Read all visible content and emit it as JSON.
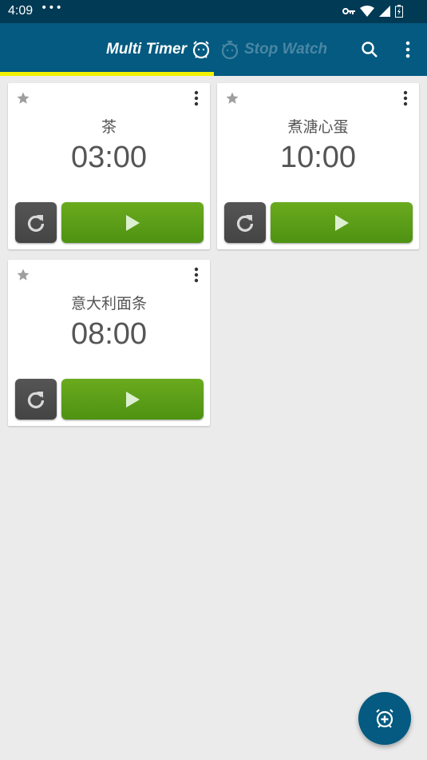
{
  "status_bar": {
    "time": "4:09",
    "overflow": "•••",
    "icons": [
      "vpn-key-icon",
      "wifi-icon",
      "signal-icon",
      "battery-charging-icon"
    ]
  },
  "app_bar": {
    "tabs": [
      {
        "label": "Multi Timer",
        "icon": "alarm-clock-face-icon",
        "selected": true
      },
      {
        "label": "Stop Watch",
        "icon": "stopwatch-face-icon",
        "selected": false
      }
    ],
    "actions": [
      "search-icon",
      "more-vert-icon"
    ],
    "indicator_color": "#f2f200",
    "background_color": "#045a80"
  },
  "timers": [
    {
      "name": "茶",
      "time": "03:00",
      "favorite": false
    },
    {
      "name": "煮溏心蛋",
      "time": "10:00",
      "favorite": false
    },
    {
      "name": "意大利面条",
      "time": "08:00",
      "favorite": false
    }
  ],
  "fab": {
    "icon": "add-alarm-icon",
    "color": "#045a80"
  }
}
